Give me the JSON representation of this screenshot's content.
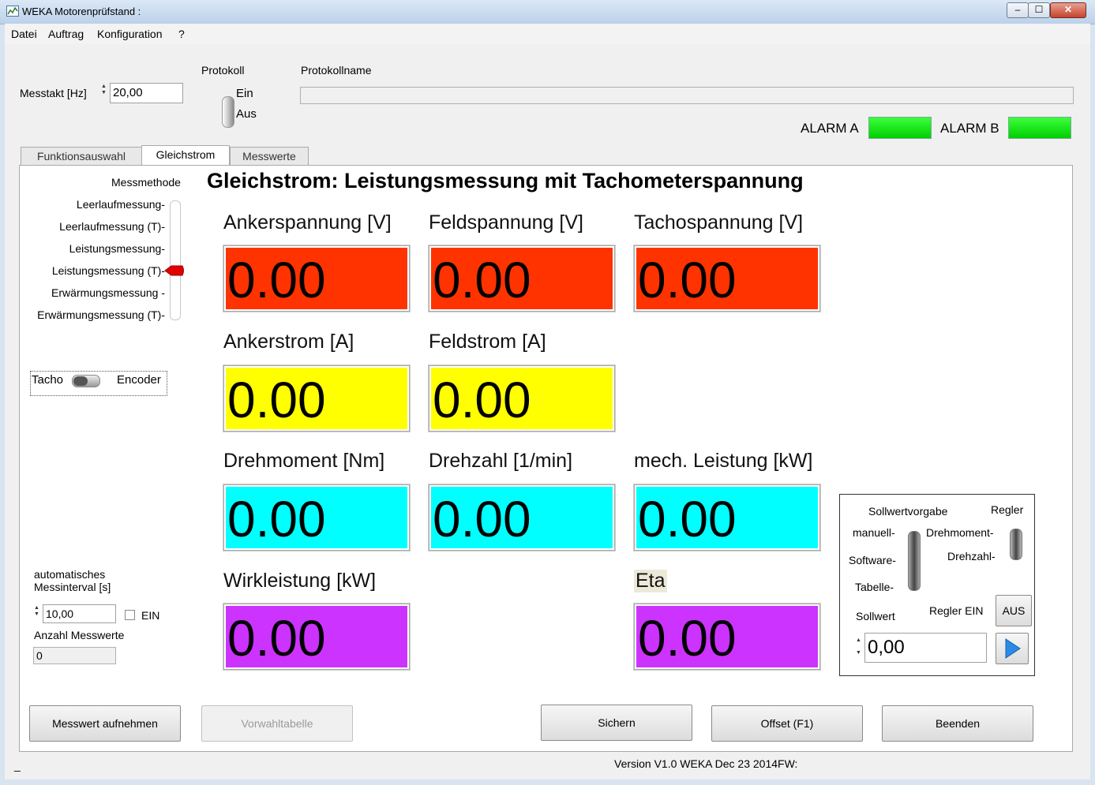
{
  "window": {
    "title": "WEKA Motorenprüfstand :",
    "min": "▭",
    "max": "☐",
    "close": "✕"
  },
  "menu": [
    "Datei",
    "Auftrag",
    "Konfiguration",
    "?"
  ],
  "top": {
    "messtakt_label": "Messtakt [Hz]",
    "messtakt_value": "20,00",
    "protokoll_label": "Protokoll",
    "protokoll_ein": "Ein",
    "protokoll_aus": "Aus",
    "protokollname_label": "Protokollname",
    "protokollname_value": "",
    "alarm_a": "ALARM A",
    "alarm_b": "ALARM B",
    "alarm_color": "#00e000"
  },
  "tabs": [
    "Funktionsauswahl",
    "Gleichstrom",
    "Messwerte"
  ],
  "left": {
    "messmethode_label": "Messmethode",
    "methods": [
      "Leerlaufmessung",
      "Leerlaufmessung (T)",
      "Leistungsmessung",
      "Leistungsmessung (T)",
      "Erwärmungsmessung",
      "Erwärmungsmessung (T)"
    ],
    "selected_index": 3,
    "tacho": "Tacho",
    "encoder": "Encoder",
    "auto_label_1": "automatisches",
    "auto_label_2": "Messinterval [s]",
    "auto_value": "10,00",
    "ein_label": "EIN",
    "anzahl_label": "Anzahl Messwerte",
    "anzahl_value": "0"
  },
  "heading": "Gleichstrom: Leistungsmessung mit Tachometerspannung",
  "measurements": {
    "ankerspannung": {
      "label": "Ankerspannung [V]",
      "value": "0.00",
      "color": "#ff3300"
    },
    "feldspannung": {
      "label": "Feldspannung [V]",
      "value": "0.00",
      "color": "#ff3300"
    },
    "tachospannung": {
      "label": "Tachospannung [V]",
      "value": "0.00",
      "color": "#ff3300"
    },
    "ankerstrom": {
      "label": "Ankerstrom [A]",
      "value": "0.00",
      "color": "#ffff00"
    },
    "feldstrom": {
      "label": "Feldstrom [A]",
      "value": "0.00",
      "color": "#ffff00"
    },
    "drehmoment": {
      "label": "Drehmoment [Nm]",
      "value": "0.00",
      "color": "#00ffff"
    },
    "drehzahl": {
      "label": "Drehzahl [1/min]",
      "value": "0.00",
      "color": "#00ffff"
    },
    "mech_leistung": {
      "label": "mech. Leistung [kW]",
      "value": "0.00",
      "color": "#00ffff"
    },
    "wirkleistung": {
      "label": "Wirkleistung [kW]",
      "value": "0.00",
      "color": "#cc33ff"
    },
    "eta": {
      "label": "Eta",
      "value": "0.00",
      "color": "#cc33ff"
    }
  },
  "regler": {
    "sollwertvorgabe_label": "Sollwertvorgabe",
    "regler_label": "Regler",
    "manuell": "manuell",
    "software": "Software",
    "tabelle": "Tabelle",
    "drehmoment": "Drehmoment",
    "drehzahl": "Drehzahl",
    "sollwert_label": "Sollwert",
    "regler_ein": "Regler EIN",
    "aus": "AUS",
    "sollwert_value": "0,00"
  },
  "buttons": {
    "messwert": "Messwert aufnehmen",
    "vorwahl": "Vorwahltabelle",
    "sichern": "Sichern",
    "offset": "Offset (F1)",
    "beenden": "Beenden"
  },
  "status": {
    "left": "_",
    "version": "Version V1.0 WEKA Dec 23 2014FW:"
  }
}
